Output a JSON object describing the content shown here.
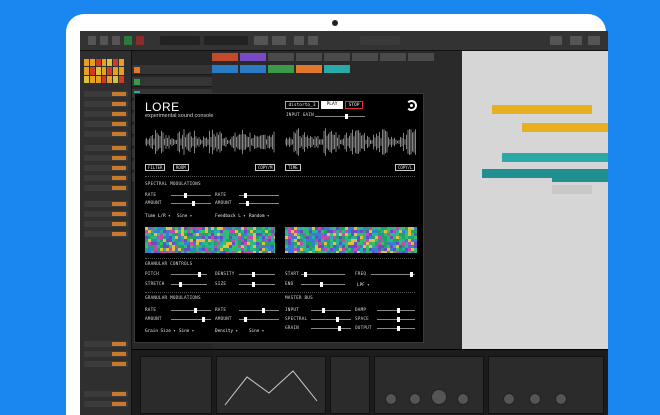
{
  "lore": {
    "title": "LORE",
    "subtitle": "experimental sound console",
    "preset": "distorto_3",
    "play_label": "PLAY",
    "stop_label": "STOP",
    "input_gain_label": "INPUT GAIN",
    "input_gain_value": 0.62,
    "filter_label": "FILTER",
    "room_label": "ROOM",
    "copy_left_label": "COPY/M",
    "time_label": "TIME",
    "copy_right_label": "COPY/L",
    "spectral_modulations": {
      "heading": "SPECTRAL MODULATIONS",
      "rate_a_label": "RATE",
      "rate_a_value": 0.35,
      "amount_a_label": "AMOUNT",
      "amount_a_value": 0.55,
      "rate_b_label": "RATE",
      "rate_b_value": 0.15,
      "amount_b_label": "AMOUNT",
      "amount_b_value": 0.2,
      "mod_target_a": "Time L/R",
      "mod_shape_a": "Sine",
      "mod_target_b": "Feedback L",
      "mod_shape_b": "Random"
    },
    "granular_controls": {
      "heading": "GRANULAR CONTROLS",
      "pitch_label": "PITCH",
      "pitch_value": 0.78,
      "stretch_label": "STRETCH",
      "stretch_value": 0.25,
      "density_label": "DENSITY",
      "density_value": 0.4,
      "size_label": "SIZE",
      "size_value": 0.4,
      "start_label": "START",
      "start_value": 0.08,
      "end_label": "END",
      "end_value": 0.45,
      "freq_label": "FREQ",
      "freq_value": 0.9,
      "filter_type": "LPF"
    },
    "granular_modulations": {
      "heading": "GRANULAR MODULATIONS",
      "rate_a_label": "RATE",
      "rate_a_value": 0.6,
      "amount_a_label": "AMOUNT",
      "amount_a_value": 0.8,
      "rate_b_label": "RATE",
      "rate_b_value": 0.6,
      "amount_b_label": "AMOUNT",
      "amount_b_value": 0.15,
      "mod_target_a": "Grain Size",
      "mod_shape_a": "Sine",
      "mod_target_b": "Density",
      "mod_shape_b": "Sine"
    },
    "master_bus": {
      "heading": "MASTER BUS",
      "input_label": "INPUT",
      "input_value": 0.3,
      "spectral_label": "SPECTRAL",
      "spectral_value": 0.65,
      "grain_label": "GRAIN",
      "grain_value": 0.7,
      "damp_label": "DAMP",
      "damp_value": 0.55,
      "space_label": "SPACE",
      "space_value": 0.55,
      "output_label": "OUTPUT",
      "output_value": 0.55
    }
  },
  "colors": {
    "background": "#1a86f0",
    "plugin_bg": "#000000",
    "stop_border": "#dd3333"
  }
}
